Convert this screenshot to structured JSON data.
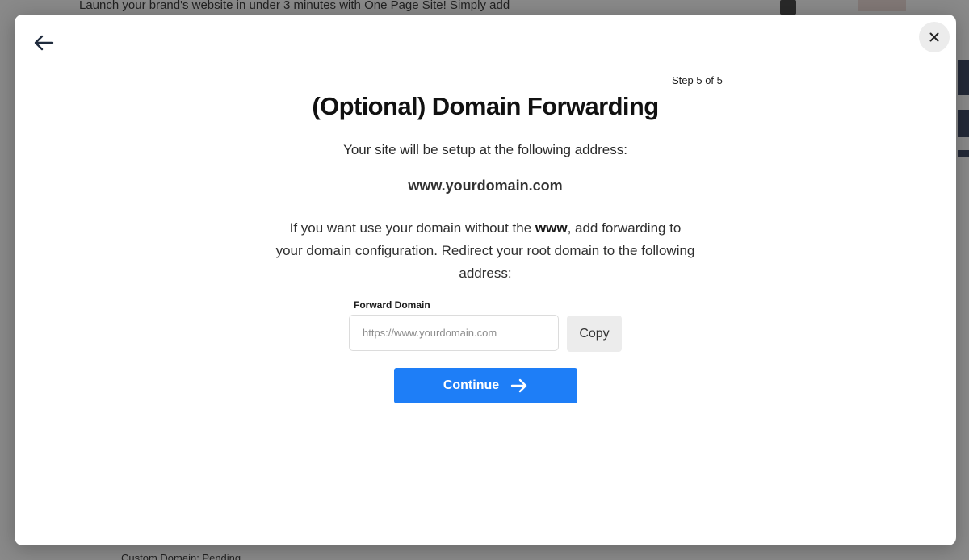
{
  "background": {
    "top_text": "Launch your brand's website in under 3 minutes with One Page Site! Simply add",
    "bottom_text": "Custom Domain: Pending"
  },
  "modal": {
    "back_icon": "arrow-left-icon",
    "close_icon": "close-icon",
    "step_label": "Step 5 of 5",
    "title": "(Optional) Domain Forwarding",
    "subtitle": "Your site will be setup at the following address:",
    "domain": "www.yourdomain.com",
    "instructions": {
      "part1": "If you want use your domain without the ",
      "emphasis": "www",
      "part2": ", add forwarding to your domain configuration. Redirect your root domain to the following address:"
    },
    "forward_field": {
      "label": "Forward Domain",
      "value": "",
      "placeholder": "https://www.yourdomain.com"
    },
    "copy_label": "Copy",
    "continue_label": "Continue",
    "continue_icon": "arrow-right-icon"
  },
  "colors": {
    "primary": "#1e7ef7",
    "title": "#111111",
    "button_gray": "#ececec"
  }
}
